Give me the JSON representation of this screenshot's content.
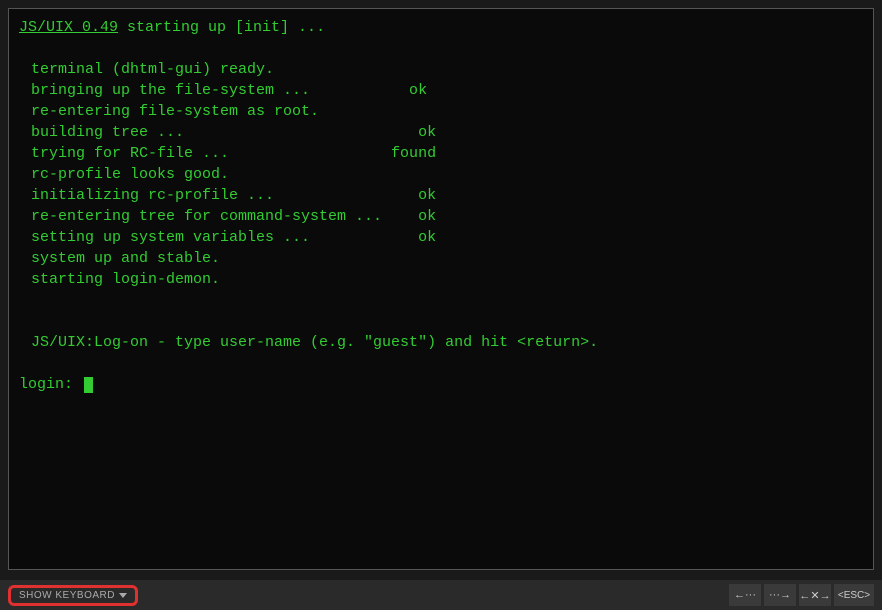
{
  "terminal": {
    "title_app": "JS/UIX 0.49",
    "title_rest": "  starting up [init] ...",
    "boot_lines": [
      "terminal (dhtml-gui) ready.",
      "bringing up the file-system ...           ok",
      "re-entering file-system as root.",
      "building tree ...                          ok",
      "trying for RC-file ...                  found",
      "rc-profile looks good.",
      "initializing rc-profile ...                ok",
      "re-entering tree for command-system ...    ok",
      "setting up system variables ...            ok",
      "system up and stable.",
      "starting login-demon."
    ],
    "logon_msg": "JS/UIX:Log-on - type user-name (e.g. \"guest\") and hit <return>.",
    "login_prompt": "login: "
  },
  "bottombar": {
    "show_keyboard": "SHOW KEYBOARD",
    "nav": {
      "back": "←···",
      "forward": "···→",
      "break": "←✕→",
      "esc": "<ESC>"
    }
  }
}
